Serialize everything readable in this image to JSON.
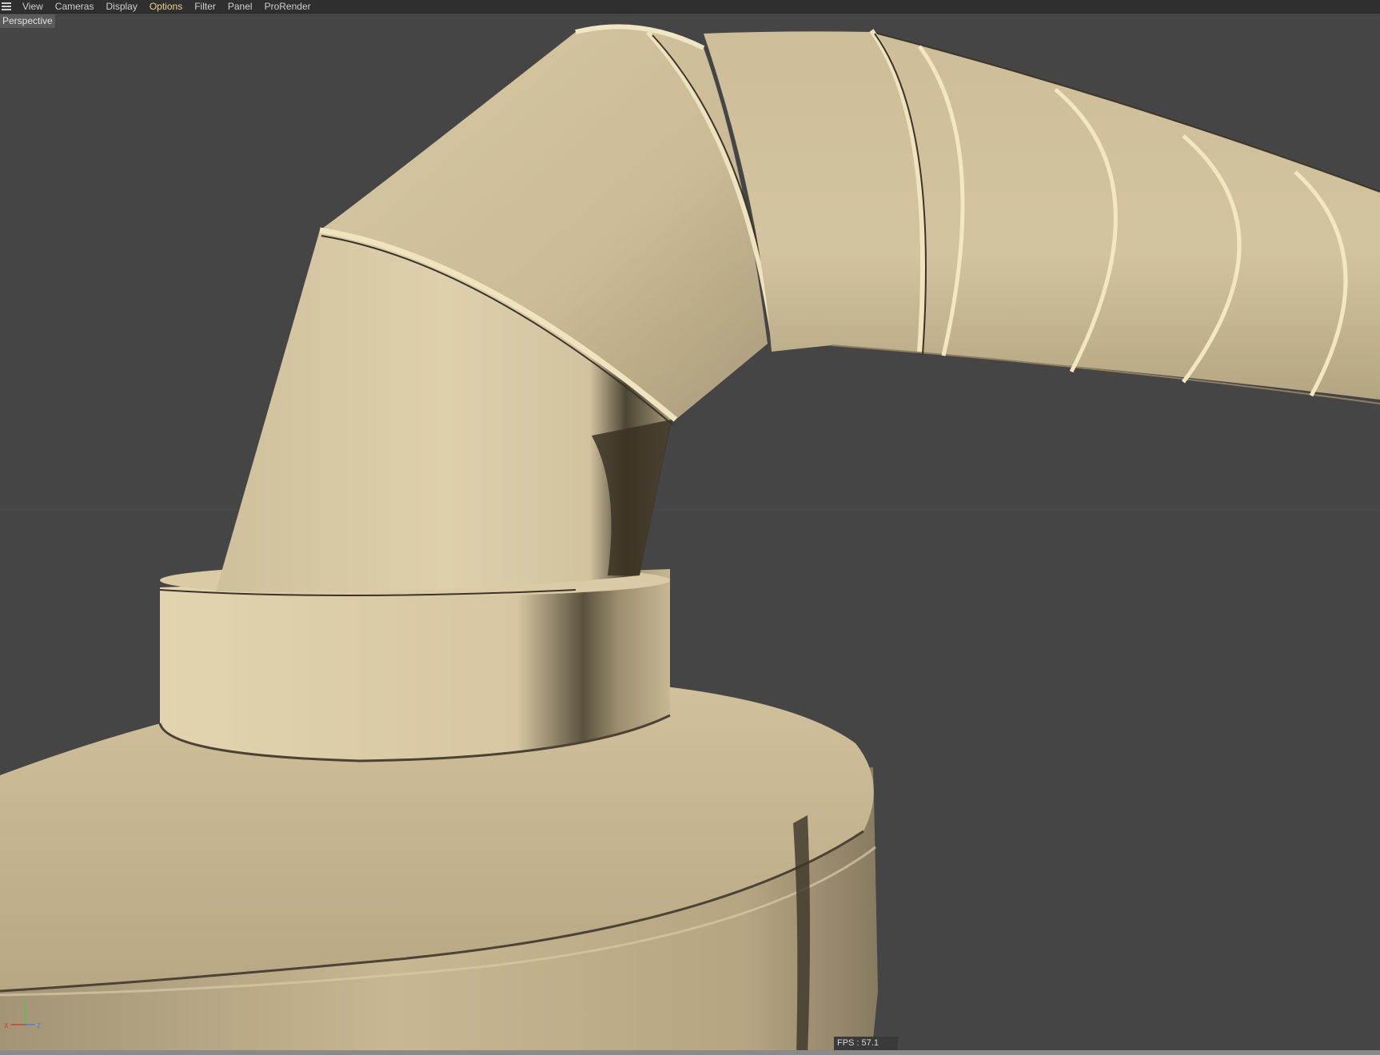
{
  "menubar": {
    "items": [
      {
        "label": "View",
        "active": false
      },
      {
        "label": "Cameras",
        "active": false
      },
      {
        "label": "Display",
        "active": false
      },
      {
        "label": "Options",
        "active": true
      },
      {
        "label": "Filter",
        "active": false
      },
      {
        "label": "Panel",
        "active": false
      },
      {
        "label": "ProRender",
        "active": false
      }
    ]
  },
  "viewport": {
    "camera_label": "Perspective",
    "fps_text": "FPS : 57.1",
    "background_color": "#454545",
    "model_color": "#d8c8a4"
  },
  "axis_gizmo": {
    "x_label": "X",
    "y_label": "Y",
    "z_label": "Z",
    "x_color": "#d23c3c",
    "y_color": "#4ec44e",
    "z_color": "#4a7de0"
  }
}
